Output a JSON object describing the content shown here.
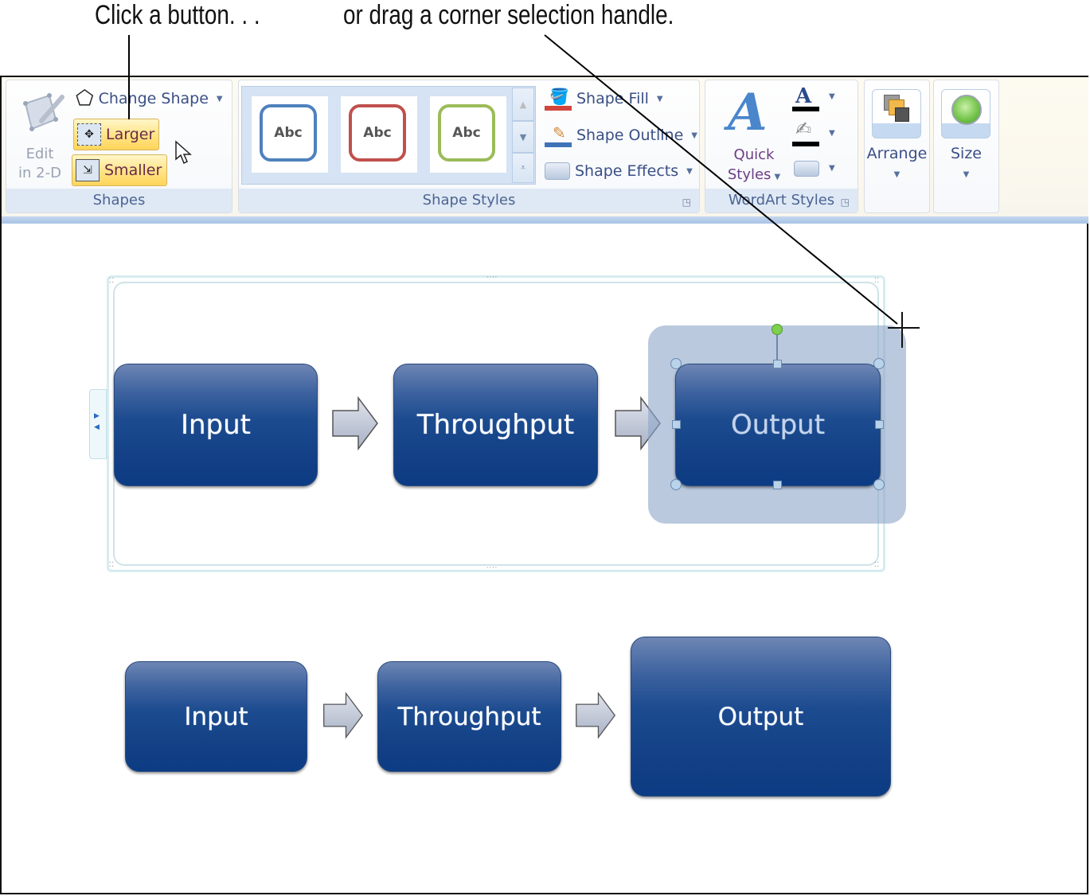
{
  "captions": {
    "left": "Click a button. . .",
    "right": "or drag a corner selection handle."
  },
  "ribbon": {
    "shapes_group": {
      "label": "Shapes",
      "edit_2d": [
        "Edit",
        "in 2-D"
      ],
      "change_shape": "Change Shape",
      "larger": "Larger",
      "smaller": "Smaller"
    },
    "shape_styles_group": {
      "label": "Shape Styles",
      "gallery": [
        {
          "text": "Abc",
          "color": "#4f81bd"
        },
        {
          "text": "Abc",
          "color": "#c0504d"
        },
        {
          "text": "Abc",
          "color": "#9bbb59"
        }
      ],
      "shape_fill": "Shape Fill",
      "shape_outline": "Shape Outline",
      "shape_effects": "Shape Effects"
    },
    "wordart_group": {
      "label": "WordArt Styles",
      "quick_styles": [
        "Quick",
        "Styles"
      ]
    },
    "arrange": "Arrange",
    "size": "Size"
  },
  "diagram": {
    "top_row": [
      "Input",
      "Throughput",
      "Output"
    ],
    "bottom_row": [
      "Input",
      "Throughput",
      "Output"
    ],
    "selected": "Output"
  }
}
